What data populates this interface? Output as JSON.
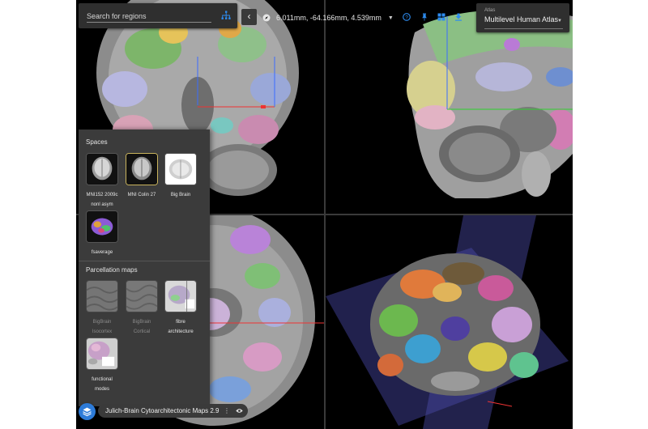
{
  "search": {
    "placeholder": "Search for regions"
  },
  "toolbar": {
    "coordinates": "6.011mm, -64.166mm, 4.539mm",
    "atlas_label": "Atlas",
    "atlas_value": "Multilevel Human Atlas",
    "accent_color": "#2d7bd8"
  },
  "icons": [
    "hierarchy-icon",
    "chevron-left-icon",
    "compass-icon",
    "chevron-down-icon",
    "help-icon",
    "pin-icon",
    "grid-icon",
    "download-icon",
    "layers-icon",
    "more-vert-icon",
    "eye-icon"
  ],
  "layer_panel": {
    "spaces_title": "Spaces",
    "spaces": [
      {
        "label_line1": "MNI152 2009c",
        "label_line2": "nonl asym",
        "selected": false
      },
      {
        "label_line1": "MNI Colin 27",
        "label_line2": "",
        "selected": true
      },
      {
        "label_line1": "Big Brain",
        "label_line2": "",
        "selected": false
      },
      {
        "label_line1": "fsaverage",
        "label_line2": "",
        "selected": false
      }
    ],
    "parcellation_title": "Parcellation maps",
    "parcellations": [
      {
        "label_line1": "BigBrain",
        "label_line2": "Isocortex",
        "enabled": false
      },
      {
        "label_line1": "BigBrain",
        "label_line2": "Cortical",
        "enabled": false
      },
      {
        "label_line1": "fibre",
        "label_line2": "architecture",
        "enabled": true
      },
      {
        "label_line1": "functional",
        "label_line2": "modes",
        "enabled": true
      }
    ]
  },
  "bottom_chip": {
    "label": "Julich-Brain Cytoarchitectonic Maps 2.9"
  }
}
